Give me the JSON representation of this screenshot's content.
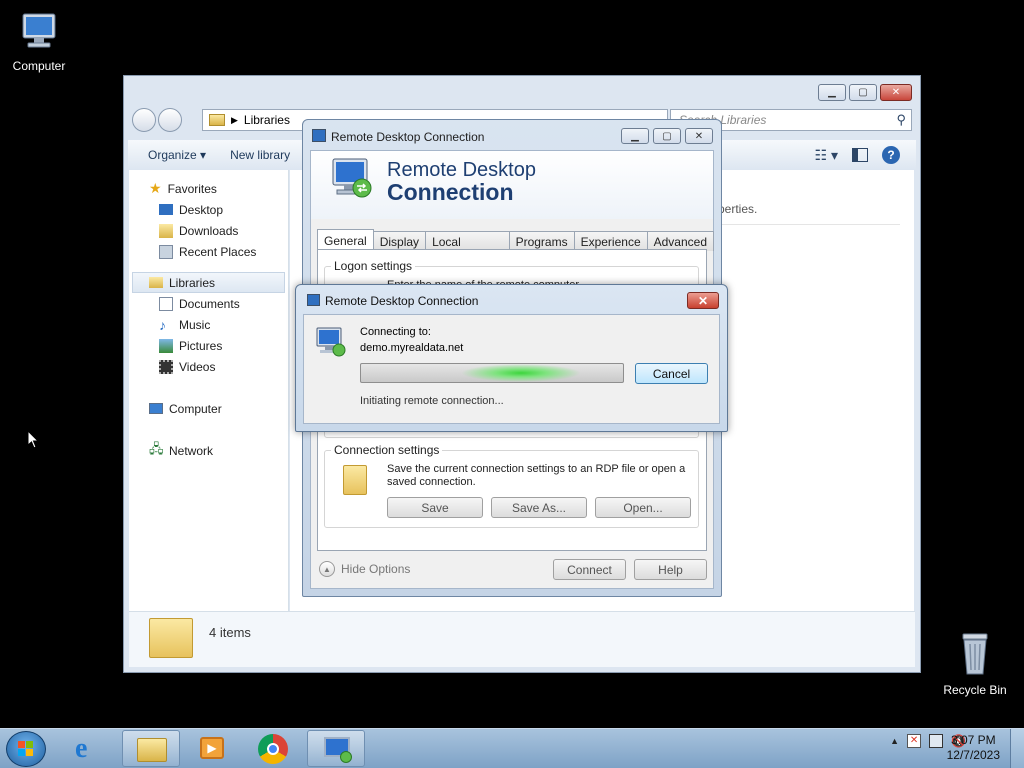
{
  "desktop": {
    "computer_label": "Computer",
    "recycle_label": "Recycle Bin"
  },
  "explorer": {
    "breadcrumb": "Libraries",
    "search_placeholder": "Search Libraries",
    "organize": "Organize ▾",
    "new_library": "New library",
    "content_text": "perties.",
    "status_items": "4 items",
    "nav": {
      "favorites": "Favorites",
      "desktop": "Desktop",
      "downloads": "Downloads",
      "recent": "Recent Places",
      "libraries": "Libraries",
      "documents": "Documents",
      "music": "Music",
      "pictures": "Pictures",
      "videos": "Videos",
      "computer": "Computer",
      "network": "Network"
    }
  },
  "rdc": {
    "title": "Remote Desktop Connection",
    "banner_line1": "Remote Desktop",
    "banner_line2": "Connection",
    "tabs": [
      "General",
      "Display",
      "Local Resources",
      "Programs",
      "Experience",
      "Advanced"
    ],
    "logon_label": "Logon settings",
    "logon_partial": "Enter the name of the remote computer.",
    "conn_label": "Connection settings",
    "conn_text": "Save the current connection settings to an RDP file or open a saved connection.",
    "save": "Save",
    "save_as": "Save As...",
    "open": "Open...",
    "hide_options": "Hide Options",
    "connect": "Connect",
    "help": "Help"
  },
  "progress": {
    "title": "Remote Desktop Connection",
    "connecting_to": "Connecting to:",
    "host": "demo.myrealdata.net",
    "cancel": "Cancel",
    "status": "Initiating remote connection..."
  },
  "taskbar": {
    "time": "3:07 PM",
    "date": "12/7/2023"
  }
}
